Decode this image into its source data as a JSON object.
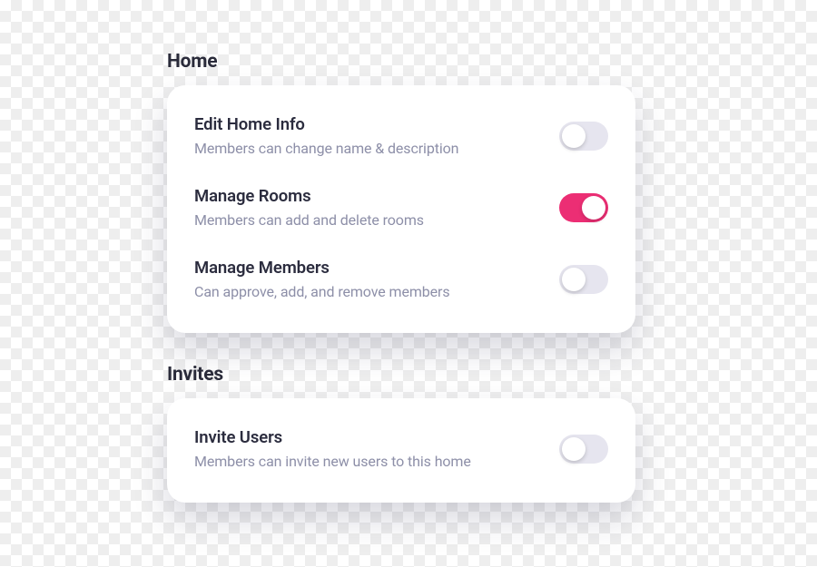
{
  "sections": [
    {
      "title": "Home",
      "items": [
        {
          "title": "Edit Home Info",
          "description": "Members can change name & description",
          "on": false
        },
        {
          "title": "Manage Rooms",
          "description": "Members can add and delete rooms",
          "on": true
        },
        {
          "title": "Manage Members",
          "description": "Can approve, add, and remove members",
          "on": false
        }
      ]
    },
    {
      "title": "Invites",
      "items": [
        {
          "title": "Invite Users",
          "description": "Members can invite new users to this home",
          "on": false
        }
      ]
    }
  ]
}
